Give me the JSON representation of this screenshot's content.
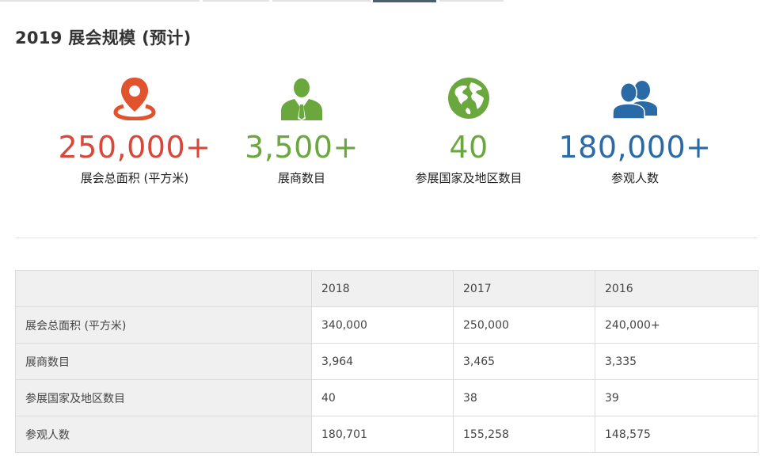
{
  "title": "2019 展会规模 (预计)",
  "colors": {
    "orange": "#e0532c",
    "green": "#6aa83d",
    "blue": "#2a6aa7",
    "red_value": "#d9473a"
  },
  "stats": [
    {
      "icon": "map-pin-icon",
      "value": "250,000+",
      "label": "展会总面积 (平方米)"
    },
    {
      "icon": "businessman-icon",
      "value": "3,500+",
      "label": "展商数目"
    },
    {
      "icon": "globe-icon",
      "value": "40",
      "label": "参展国家及地区数目"
    },
    {
      "icon": "people-icon",
      "value": "180,000+",
      "label": "参观人数"
    }
  ],
  "table": {
    "headers": [
      "",
      "2018",
      "2017",
      "2016"
    ],
    "rows": [
      [
        "展会总面积 (平方米)",
        "340,000",
        "250,000",
        "240,000+"
      ],
      [
        "展商数目",
        "3,964",
        "3,465",
        "3,335"
      ],
      [
        "参展国家及地区数目",
        "40",
        "38",
        "39"
      ],
      [
        "参观人数",
        "180,701",
        "155,258",
        "148,575"
      ]
    ]
  }
}
